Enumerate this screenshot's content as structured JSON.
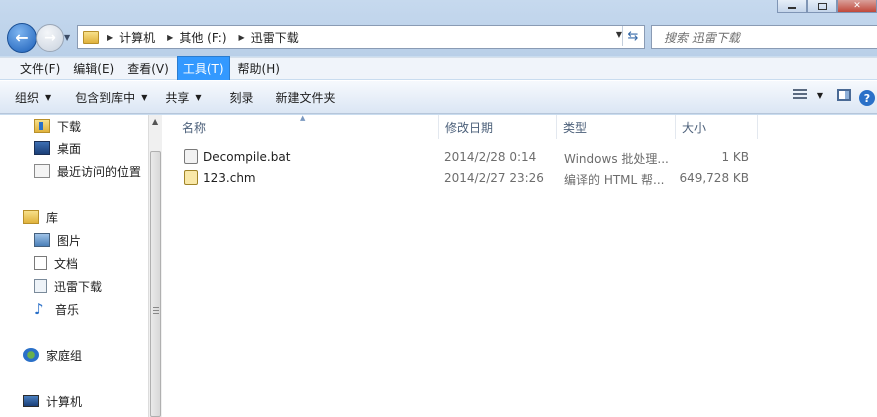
{
  "address": {
    "crumbs": [
      "计算机",
      "其他 (F:)",
      "迅雷下载"
    ]
  },
  "search": {
    "placeholder": "搜索 迅雷下载"
  },
  "menu": [
    {
      "label": "文件(F)",
      "active": false
    },
    {
      "label": "编辑(E)",
      "active": false
    },
    {
      "label": "查看(V)",
      "active": false
    },
    {
      "label": "工具(T)",
      "active": true
    },
    {
      "label": "帮助(H)",
      "active": false
    }
  ],
  "toolbar": {
    "organize": "组织",
    "include_in_library": "包含到库中",
    "share": "共享",
    "burn": "刻录",
    "new_folder": "新建文件夹",
    "help": "?"
  },
  "nav": {
    "favorites": [
      "下载",
      "桌面",
      "最近访问的位置"
    ],
    "libraries_label": "库",
    "libraries": [
      "图片",
      "文档",
      "迅雷下载",
      "音乐"
    ],
    "homegroup": "家庭组",
    "computer": "计算机"
  },
  "columns": {
    "name": "名称",
    "date": "修改日期",
    "type": "类型",
    "size": "大小"
  },
  "files": [
    {
      "name": "Decompile.bat",
      "date": "2014/2/28 0:14",
      "type": "Windows 批处理...",
      "size": "1 KB",
      "icon": "batch-file-icon"
    },
    {
      "name": "123.chm",
      "date": "2014/2/27 23:26",
      "type": "编译的 HTML 帮...",
      "size": "649,728 KB",
      "icon": "chm-help-file-icon"
    }
  ]
}
